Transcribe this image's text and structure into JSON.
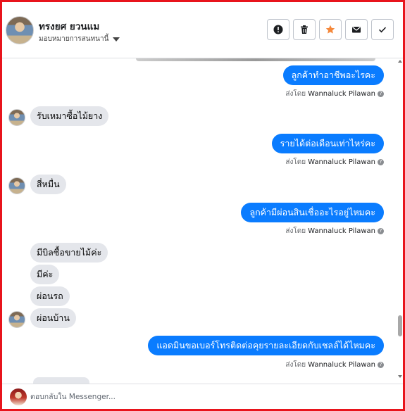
{
  "header": {
    "name": "ทรงยศ ยวนแม",
    "assign_label": "มอบหมายการสนทนานี้"
  },
  "actions": [
    {
      "name": "report-button",
      "icon": "exclamation-icon"
    },
    {
      "name": "delete-button",
      "icon": "trash-icon"
    },
    {
      "name": "star-button",
      "icon": "star-icon"
    },
    {
      "name": "mark-unread-button",
      "icon": "envelope-icon"
    },
    {
      "name": "mark-done-button",
      "icon": "check-icon"
    }
  ],
  "messages": {
    "out1": "ลูกค้าทำอาชีพอะไรคะ",
    "in1": "รับเหมาซื้อไม้ยาง",
    "out2": "รายได้ต่อเดือนเท่าไหร่คะ",
    "in2": "สี่หมื่น",
    "out3": "ลูกค้ามีผ่อนสินเชื่ออะไรอยู่ไหมคะ",
    "in3a": "มีบิลซื้อขายไม้ค่ะ",
    "in3b": "มีค่ะ",
    "in3c": "ผ่อนรถ",
    "in3d": "ผ่อนบ้าน",
    "out4": "แอดมินขอเบอร์โทรติดต่อคุยรายละเอียดกับเชลล์ได้ไหมคะ"
  },
  "sent_by": {
    "prefix": "ส่งโดย",
    "agent": "Wannaluck Pilawan",
    "help": "?"
  },
  "reply": {
    "placeholder": "ตอบกลับใน Messenger..."
  },
  "colors": {
    "outgoing_bubble": "#0a7cff",
    "incoming_bubble": "#e4e6eb",
    "star": "#f5883a",
    "frame_border": "#e8141c"
  }
}
